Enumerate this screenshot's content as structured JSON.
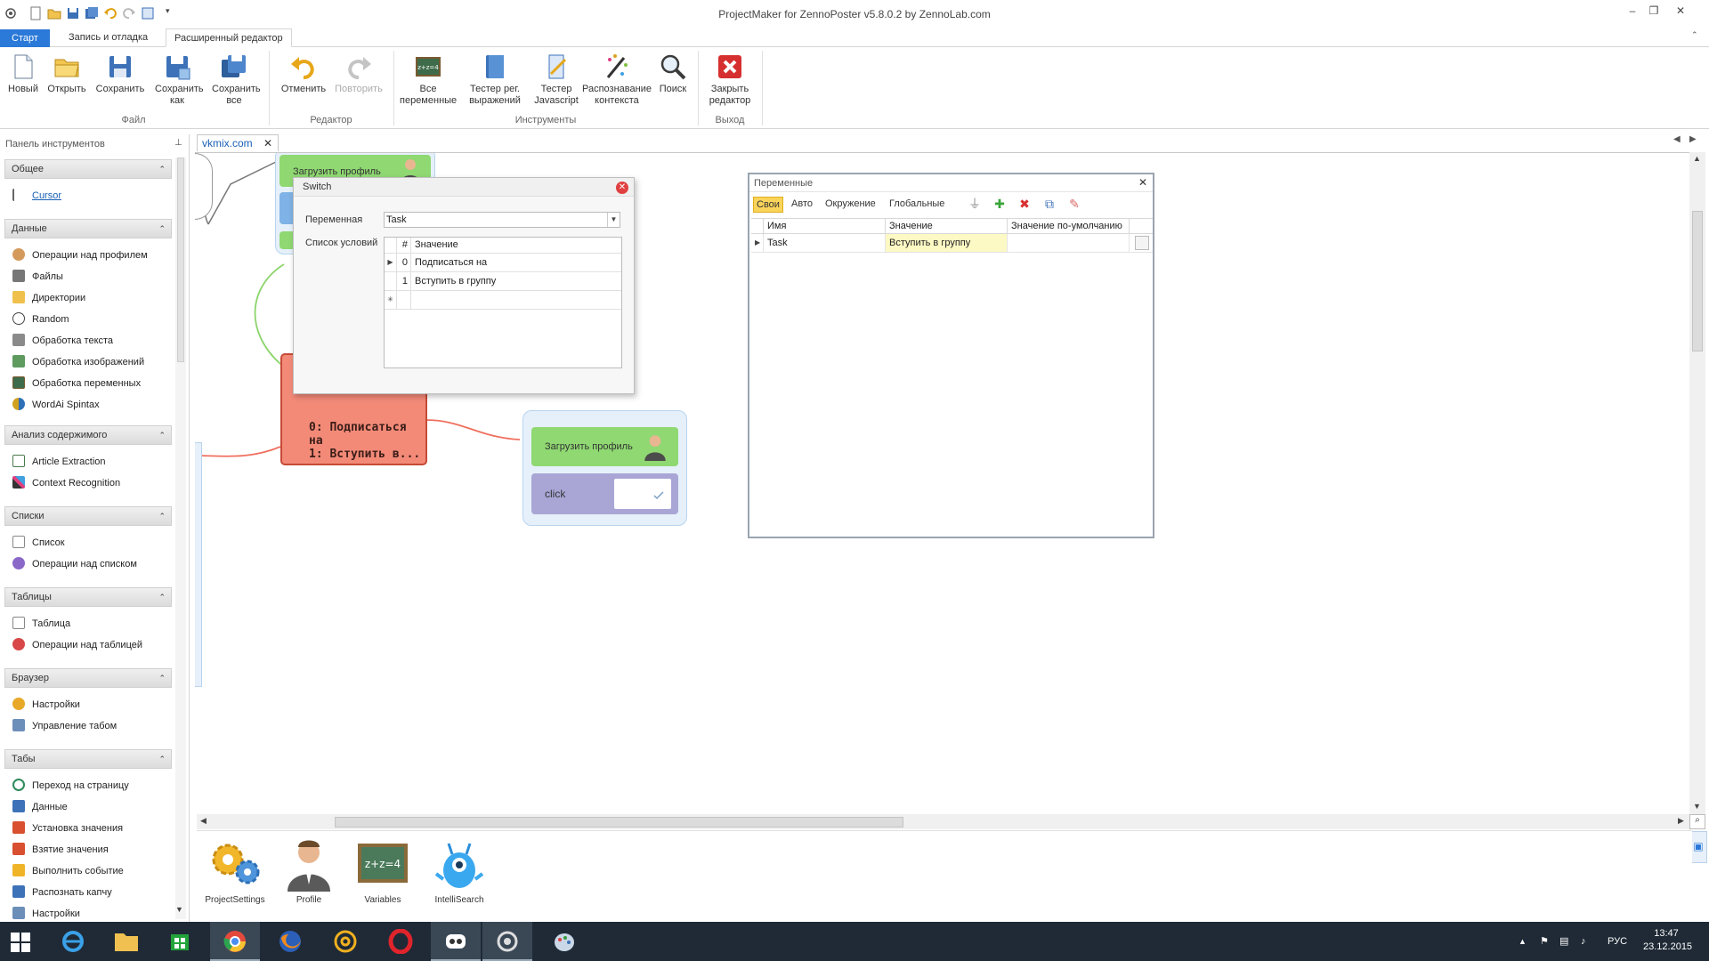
{
  "window": {
    "title": "ProjectMaker for ZennoPoster v5.8.0.2 by ZennoLab.com"
  },
  "ribbon_tabs": [
    {
      "label": "Старт"
    },
    {
      "label": "Запись и отладка"
    },
    {
      "label": "Расширенный редактор"
    }
  ],
  "ribbon": {
    "file": {
      "group_label": "Файл",
      "new": "Новый",
      "open": "Открыть",
      "save": "Сохранить",
      "save_as": "Сохранить как",
      "save_all": "Сохранить все"
    },
    "editor": {
      "group_label": "Редактор",
      "undo": "Отменить",
      "redo": "Повторить"
    },
    "tools": {
      "group_label": "Инструменты",
      "all_vars": "Все переменные",
      "regex_tester": "Тестер рег. выражений",
      "js_tester": "Тестер Javascript",
      "context_recognition": "Распознавание контекста",
      "search": "Поиск"
    },
    "exit": {
      "group_label": "Выход",
      "close_editor": "Закрыть редактор"
    }
  },
  "toolbox": {
    "header": "Панель инструментов",
    "groups": [
      {
        "title": "Общее",
        "items": [
          {
            "label": "Cursor"
          }
        ]
      },
      {
        "title": "Данные",
        "items": [
          {
            "label": "Операции над профилем"
          },
          {
            "label": "Файлы"
          },
          {
            "label": "Директории"
          },
          {
            "label": "Random"
          },
          {
            "label": "Обработка текста"
          },
          {
            "label": "Обработка изображений"
          },
          {
            "label": "Обработка переменных"
          },
          {
            "label": "WordAi Spintax"
          }
        ]
      },
      {
        "title": "Анализ содержимого",
        "items": [
          {
            "label": "Article Extraction"
          },
          {
            "label": "Context Recognition"
          }
        ]
      },
      {
        "title": "Списки",
        "items": [
          {
            "label": "Список"
          },
          {
            "label": "Операции над списком"
          }
        ]
      },
      {
        "title": "Таблицы",
        "items": [
          {
            "label": "Таблица"
          },
          {
            "label": "Операции над таблицей"
          }
        ]
      },
      {
        "title": "Браузер",
        "items": [
          {
            "label": "Настройки"
          },
          {
            "label": "Управление табом"
          }
        ]
      },
      {
        "title": "Табы",
        "items": [
          {
            "label": "Переход на страницу"
          },
          {
            "label": "Данные"
          },
          {
            "label": "Установка значения"
          },
          {
            "label": "Взятие значения"
          },
          {
            "label": "Выполнить событие"
          },
          {
            "label": "Распознать капчу"
          },
          {
            "label": "Настройки"
          }
        ]
      }
    ]
  },
  "document_tab": {
    "label": "vkmix.com"
  },
  "canvas": {
    "load_profile_top": "Загрузить профиль",
    "switch_case_0": "0: Подписаться на",
    "switch_case_1": "1: Вступить в...",
    "load_profile_right": "Загрузить профиль",
    "click_node": "click"
  },
  "switch_dialog": {
    "title": "Switch",
    "variable_label": "Переменная",
    "variable_value": "Task",
    "conditions_label": "Список условий",
    "col_num": "#",
    "col_value": "Значение",
    "rows": [
      {
        "num": "0",
        "value": "Подписаться на"
      },
      {
        "num": "1",
        "value": "Вступить в группу"
      }
    ]
  },
  "variables_panel": {
    "title": "Переменные",
    "filters": [
      {
        "label": "Свои",
        "selected": true
      },
      {
        "label": "Авто"
      },
      {
        "label": "Окружение"
      },
      {
        "label": "Глобальные"
      }
    ],
    "columns": {
      "name": "Имя",
      "value": "Значение",
      "default": "Значение по-умолчанию"
    },
    "rows": [
      {
        "name": "Task",
        "value": "Вступить в группу",
        "default": ""
      }
    ]
  },
  "bottom_bar": [
    {
      "label": "ProjectSettings"
    },
    {
      "label": "Profile"
    },
    {
      "label": "Variables"
    },
    {
      "label": "IntelliSearch"
    }
  ],
  "taskbar": {
    "language": "РУС",
    "time": "13:47",
    "date": "23.12.2015"
  },
  "colors": {
    "start_tab": "#2b79d8",
    "switch_node": "#f38a78",
    "green_node": "#8fd872",
    "purple_node": "#a9a6d6",
    "selected_filter": "#f9d45a",
    "value_cell": "#fdf9c4"
  }
}
